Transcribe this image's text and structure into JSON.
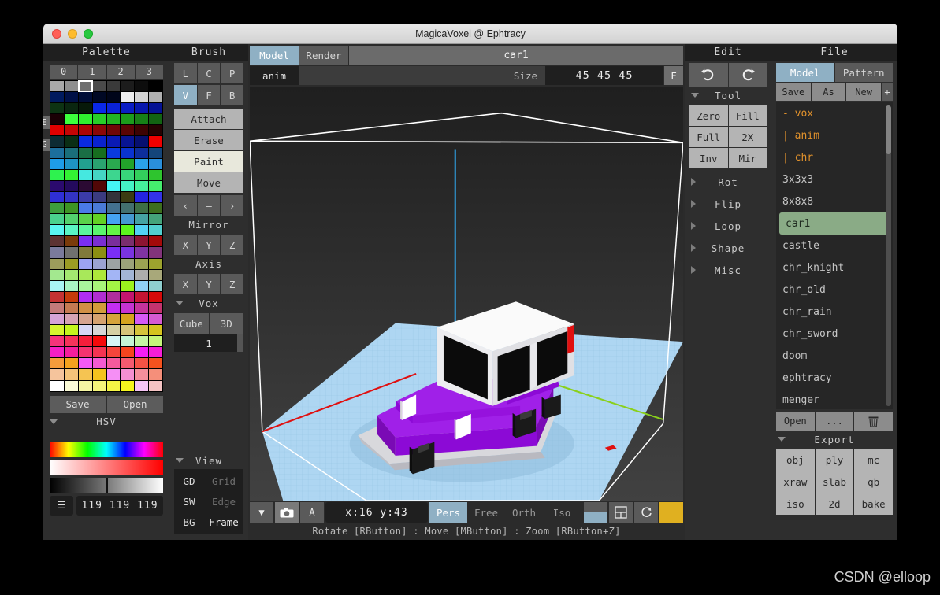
{
  "window": {
    "title": "MagicaVoxel @ Ephtracy"
  },
  "palette": {
    "title": "Palette",
    "column_numbers": [
      "0",
      "1",
      "2",
      "3"
    ],
    "edge_labels": {
      "e": "E",
      "g": "G"
    },
    "selected_index": 2,
    "save_label": "Save",
    "open_label": "Open",
    "colors": [
      "#a8a8a8",
      "#8f8f8f",
      "#6e6e6e",
      "#4a4a4a",
      "#3a3a3a",
      "#1c1c1c",
      "#0d0d0d",
      "#000000",
      "#001a5e",
      "#001047",
      "#000d38",
      "#000824",
      "#00051a",
      "#ededed",
      "#d4d4d4",
      "#b0b0b0",
      "#0d3313",
      "#0a2610",
      "#07190a",
      "#0a28e8",
      "#0a22d6",
      "#0a1cc4",
      "#0716ad",
      "#051294",
      "#1a0005",
      "#3cff3c",
      "#2ff02f",
      "#28cf28",
      "#22b522",
      "#1c9c1c",
      "#178017",
      "#126312",
      "#e00000",
      "#c40505",
      "#ad0505",
      "#8c0707",
      "#700707",
      "#5a0505",
      "#3d0303",
      "#260202",
      "#0d2b33",
      "#0a2e14",
      "#0a2ae0",
      "#0a22cf",
      "#0a1ab5",
      "#081494",
      "#060f70",
      "#ee0000",
      "#1c6e9c",
      "#1a6e7a",
      "#1a6e45",
      "#176e1f",
      "#0a3ae0",
      "#0a33cf",
      "#0d2e9c",
      "#14457a",
      "#1e9ce8",
      "#1e93c4",
      "#22a08f",
      "#2aa370",
      "#2aa84f",
      "#22a32a",
      "#2aa3e8",
      "#2a8fdb",
      "#2ef24f",
      "#33f233",
      "#45e8e0",
      "#45d6c4",
      "#3dd68f",
      "#38d67a",
      "#33cf5c",
      "#2ec42e",
      "#2b0a6e",
      "#240a5c",
      "#2b0a33",
      "#520707",
      "#45f5f5",
      "#45f2c4",
      "#45f09c",
      "#45ed6e",
      "#2f2fd6",
      "#3333c4",
      "#3b3ba8",
      "#3b3b80",
      "#33333a",
      "#3b3b12",
      "#2424e0",
      "#3333e8",
      "#3d9c3d",
      "#3d9424",
      "#4a7ae8",
      "#4a7ad6",
      "#43708f",
      "#43706e",
      "#3d6e45",
      "#3d6e1e",
      "#4ad18f",
      "#52d16e",
      "#5ad14a",
      "#63d124",
      "#45a3f2",
      "#4599d1",
      "#45a3a3",
      "#45a37a",
      "#5af5f2",
      "#5af5c4",
      "#5af59c",
      "#5af56e",
      "#63f545",
      "#5cf51e",
      "#52d1f5",
      "#52cfcf",
      "#5c3333",
      "#7a3b0a",
      "#7a2ef2",
      "#7a2ed1",
      "#7a2e9c",
      "#7a2e6e",
      "#8c1433",
      "#a30a0a",
      "#7a7a9c",
      "#70706e",
      "#807a3b",
      "#8c8f12",
      "#7a2ef5",
      "#7a33e0",
      "#8033a3",
      "#82337a",
      "#9c9c5c",
      "#9c9c24",
      "#9ca3f2",
      "#9ca3d1",
      "#9ca3a3",
      "#9ca37a",
      "#9ca352",
      "#9ca32e",
      "#a3e88f",
      "#a3e870",
      "#a8e85a",
      "#ade83b",
      "#a3b5f5",
      "#a3b5d6",
      "#adadad",
      "#a8a87a",
      "#a8f5f5",
      "#a8f5c4",
      "#a8f59c",
      "#a8f57a",
      "#a3f545",
      "#9cf21e",
      "#8fd1f5",
      "#8fcfcf",
      "#c43333",
      "#c43b0a",
      "#b02ef2",
      "#b02ed1",
      "#b02e9c",
      "#c4146e",
      "#c41433",
      "#d60a0a",
      "#c47a7a",
      "#c47a52",
      "#d18f45",
      "#d19c3b",
      "#c42ef2",
      "#c433d1",
      "#c4339c",
      "#c4336e",
      "#d6a3d6",
      "#d6a3b5",
      "#d6a38f",
      "#d6a370",
      "#d6a33b",
      "#d6a31e",
      "#d65af5",
      "#d65ad1",
      "#d6f52e",
      "#c4f51e",
      "#d6d6f5",
      "#d6d6d6",
      "#d6cfa3",
      "#d6c47a",
      "#d6c43b",
      "#d6c41e",
      "#f5337a",
      "#f5335a",
      "#f51e3b",
      "#f50a0a",
      "#d6f5f5",
      "#c4f5d6",
      "#c4f5a3",
      "#c4f57a",
      "#f51ec4",
      "#f51e9c",
      "#f53370",
      "#f53352",
      "#f5453b",
      "#f5451e",
      "#f51ef5",
      "#f51ed6",
      "#f59c3b",
      "#f5a31e",
      "#f55af5",
      "#f55ad1",
      "#f55a9c",
      "#f55a70",
      "#f55245",
      "#f5521e",
      "#f5c49c",
      "#f5c47a",
      "#f5c452",
      "#f5c41e",
      "#f58ff5",
      "#f58fd1",
      "#f58f9c",
      "#f58f7a",
      "#ffffff",
      "#fafad6",
      "#f5f5a3",
      "#f5f57a",
      "#f5f545",
      "#f5f51e",
      "#f5c4f5",
      "#f5c4c4"
    ]
  },
  "brush": {
    "title": "Brush",
    "mode_row1": [
      "L",
      "C",
      "P"
    ],
    "mode_row2": [
      "V",
      "F",
      "B"
    ],
    "mode_selected": "V",
    "actions": [
      "Attach",
      "Erase",
      "Paint",
      "Move"
    ],
    "action_selected": "Paint",
    "nav": [
      "‹",
      "–",
      "›"
    ],
    "mirror_title": "Mirror",
    "mirror_axes": [
      "X",
      "Y",
      "Z"
    ],
    "axis_title": "Axis",
    "axis_axes": [
      "X",
      "Y",
      "Z"
    ],
    "vox_title": "Vox",
    "vox_shapes": [
      "Cube",
      "3D"
    ],
    "vox_size": "1",
    "view_title": "View",
    "view_rows": [
      {
        "key": "GD",
        "value": "Grid",
        "on": false
      },
      {
        "key": "SW",
        "value": "Edge",
        "on": false
      },
      {
        "key": "BG",
        "value": "Frame",
        "on": true
      }
    ]
  },
  "hsv": {
    "title": "HSV",
    "menu_icon": "hamburger-icon",
    "rgb_value": "119 119 119"
  },
  "viewport": {
    "tabs": [
      {
        "label": "Model",
        "selected": true
      },
      {
        "label": "Render",
        "selected": false
      }
    ],
    "model_name": "car1",
    "anim_label": "anim",
    "size_label": "Size",
    "size_value": "45 45 45",
    "frame_label": "F",
    "bottom": {
      "dropdown_icon": "caret-down-icon",
      "camera_icon": "camera-icon",
      "a_label": "A",
      "coords": "x:16  y:43",
      "projections": [
        {
          "label": "Pers",
          "selected": true
        },
        {
          "label": "Free",
          "selected": false
        },
        {
          "label": "Orth",
          "selected": false
        },
        {
          "label": "Iso",
          "selected": false
        }
      ],
      "icons": [
        "split-view-icon",
        "layout-icon",
        "reset-rotate-icon",
        "color-swatch-icon"
      ]
    },
    "hint": "Rotate [RButton] : Move [MButton] : Zoom [RButton+Z]"
  },
  "edit": {
    "title": "Edit",
    "undo_icon": "undo-icon",
    "redo_icon": "redo-icon",
    "tool_title": "Tool",
    "tool_buttons": [
      "Zero",
      "Fill",
      "Full",
      "2X",
      "Inv",
      "Mir"
    ],
    "sections": [
      "Rot",
      "Flip",
      "Loop",
      "Shape",
      "Misc"
    ]
  },
  "file": {
    "title": "File",
    "tabs": [
      {
        "label": "Model",
        "selected": true
      },
      {
        "label": "Pattern",
        "selected": false
      }
    ],
    "ops": [
      "Save",
      "As",
      "New"
    ],
    "ops_plus": "+",
    "items": [
      {
        "label": "- vox",
        "type": "folder"
      },
      {
        "label": "| anim",
        "type": "folder"
      },
      {
        "label": "| chr",
        "type": "folder"
      },
      {
        "label": "3x3x3",
        "type": "file"
      },
      {
        "label": "8x8x8",
        "type": "file"
      },
      {
        "label": "car1",
        "type": "file",
        "selected": true
      },
      {
        "label": "castle",
        "type": "file"
      },
      {
        "label": "chr_knight",
        "type": "file"
      },
      {
        "label": "chr_old",
        "type": "file"
      },
      {
        "label": "chr_rain",
        "type": "file"
      },
      {
        "label": "chr_sword",
        "type": "file"
      },
      {
        "label": "doom",
        "type": "file"
      },
      {
        "label": "ephtracy",
        "type": "file"
      },
      {
        "label": "menger",
        "type": "file"
      }
    ],
    "bottom_buttons": [
      "Open",
      "...",
      "trash-icon"
    ],
    "export_title": "Export",
    "export_formats": [
      "obj",
      "ply",
      "mc",
      "xraw",
      "slab",
      "qb",
      "iso",
      "2d",
      "bake"
    ]
  },
  "watermark": "CSDN @elloop",
  "theme": {
    "accent_blue": "#8fb0c4",
    "selected_green": "#8aab86",
    "folder_orange": "#e0912c",
    "gold": "#e0b020",
    "floor_blue": "#aed6f2",
    "car_body": "#8c0ad6",
    "car_roof": "#f5f5f5"
  }
}
